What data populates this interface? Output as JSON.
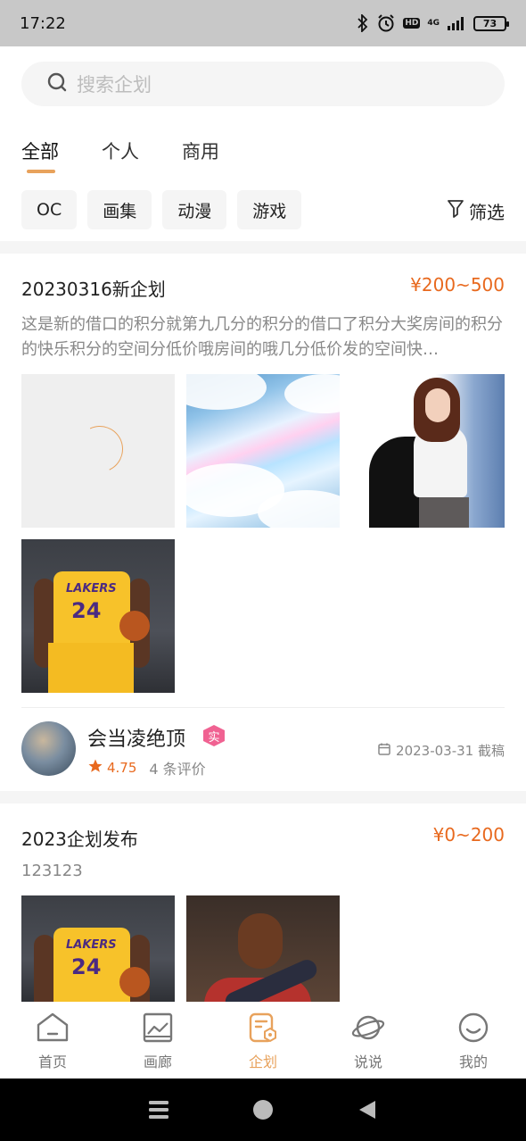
{
  "status_bar": {
    "time": "17:22",
    "network": "4G",
    "hd": "HD",
    "battery": "73"
  },
  "search": {
    "placeholder": "搜索企划"
  },
  "tabs": [
    {
      "label": "全部",
      "active": true
    },
    {
      "label": "个人",
      "active": false
    },
    {
      "label": "商用",
      "active": false
    }
  ],
  "chips": [
    "OC",
    "画集",
    "动漫",
    "游戏"
  ],
  "filter_label": "筛选",
  "colors": {
    "accent": "#e8a25c",
    "price": "#e8691e",
    "badge": "#f06292"
  },
  "cards": [
    {
      "title": "20230316新企划",
      "price": "¥200~500",
      "description": "这是新的借口的积分就第九几分的积分的借口了积分大奖房间的积分的快乐积分的空间分低价哦房间的哦几分低价发的空间快…",
      "author": {
        "name": "会当凌绝顶",
        "badge": "实",
        "rating": "4.75",
        "reviews": "4 条评价"
      },
      "deadline": "2023-03-31 截稿"
    },
    {
      "title": "2023企划发布",
      "price": "¥0~200",
      "description": "123123"
    }
  ],
  "bottom_nav": [
    {
      "label": "首页",
      "icon": "home-icon",
      "active": false
    },
    {
      "label": "画廊",
      "icon": "gallery-icon",
      "active": false
    },
    {
      "label": "企划",
      "icon": "plan-icon",
      "active": true
    },
    {
      "label": "说说",
      "icon": "planet-icon",
      "active": false
    },
    {
      "label": "我的",
      "icon": "smile-icon",
      "active": false
    }
  ]
}
